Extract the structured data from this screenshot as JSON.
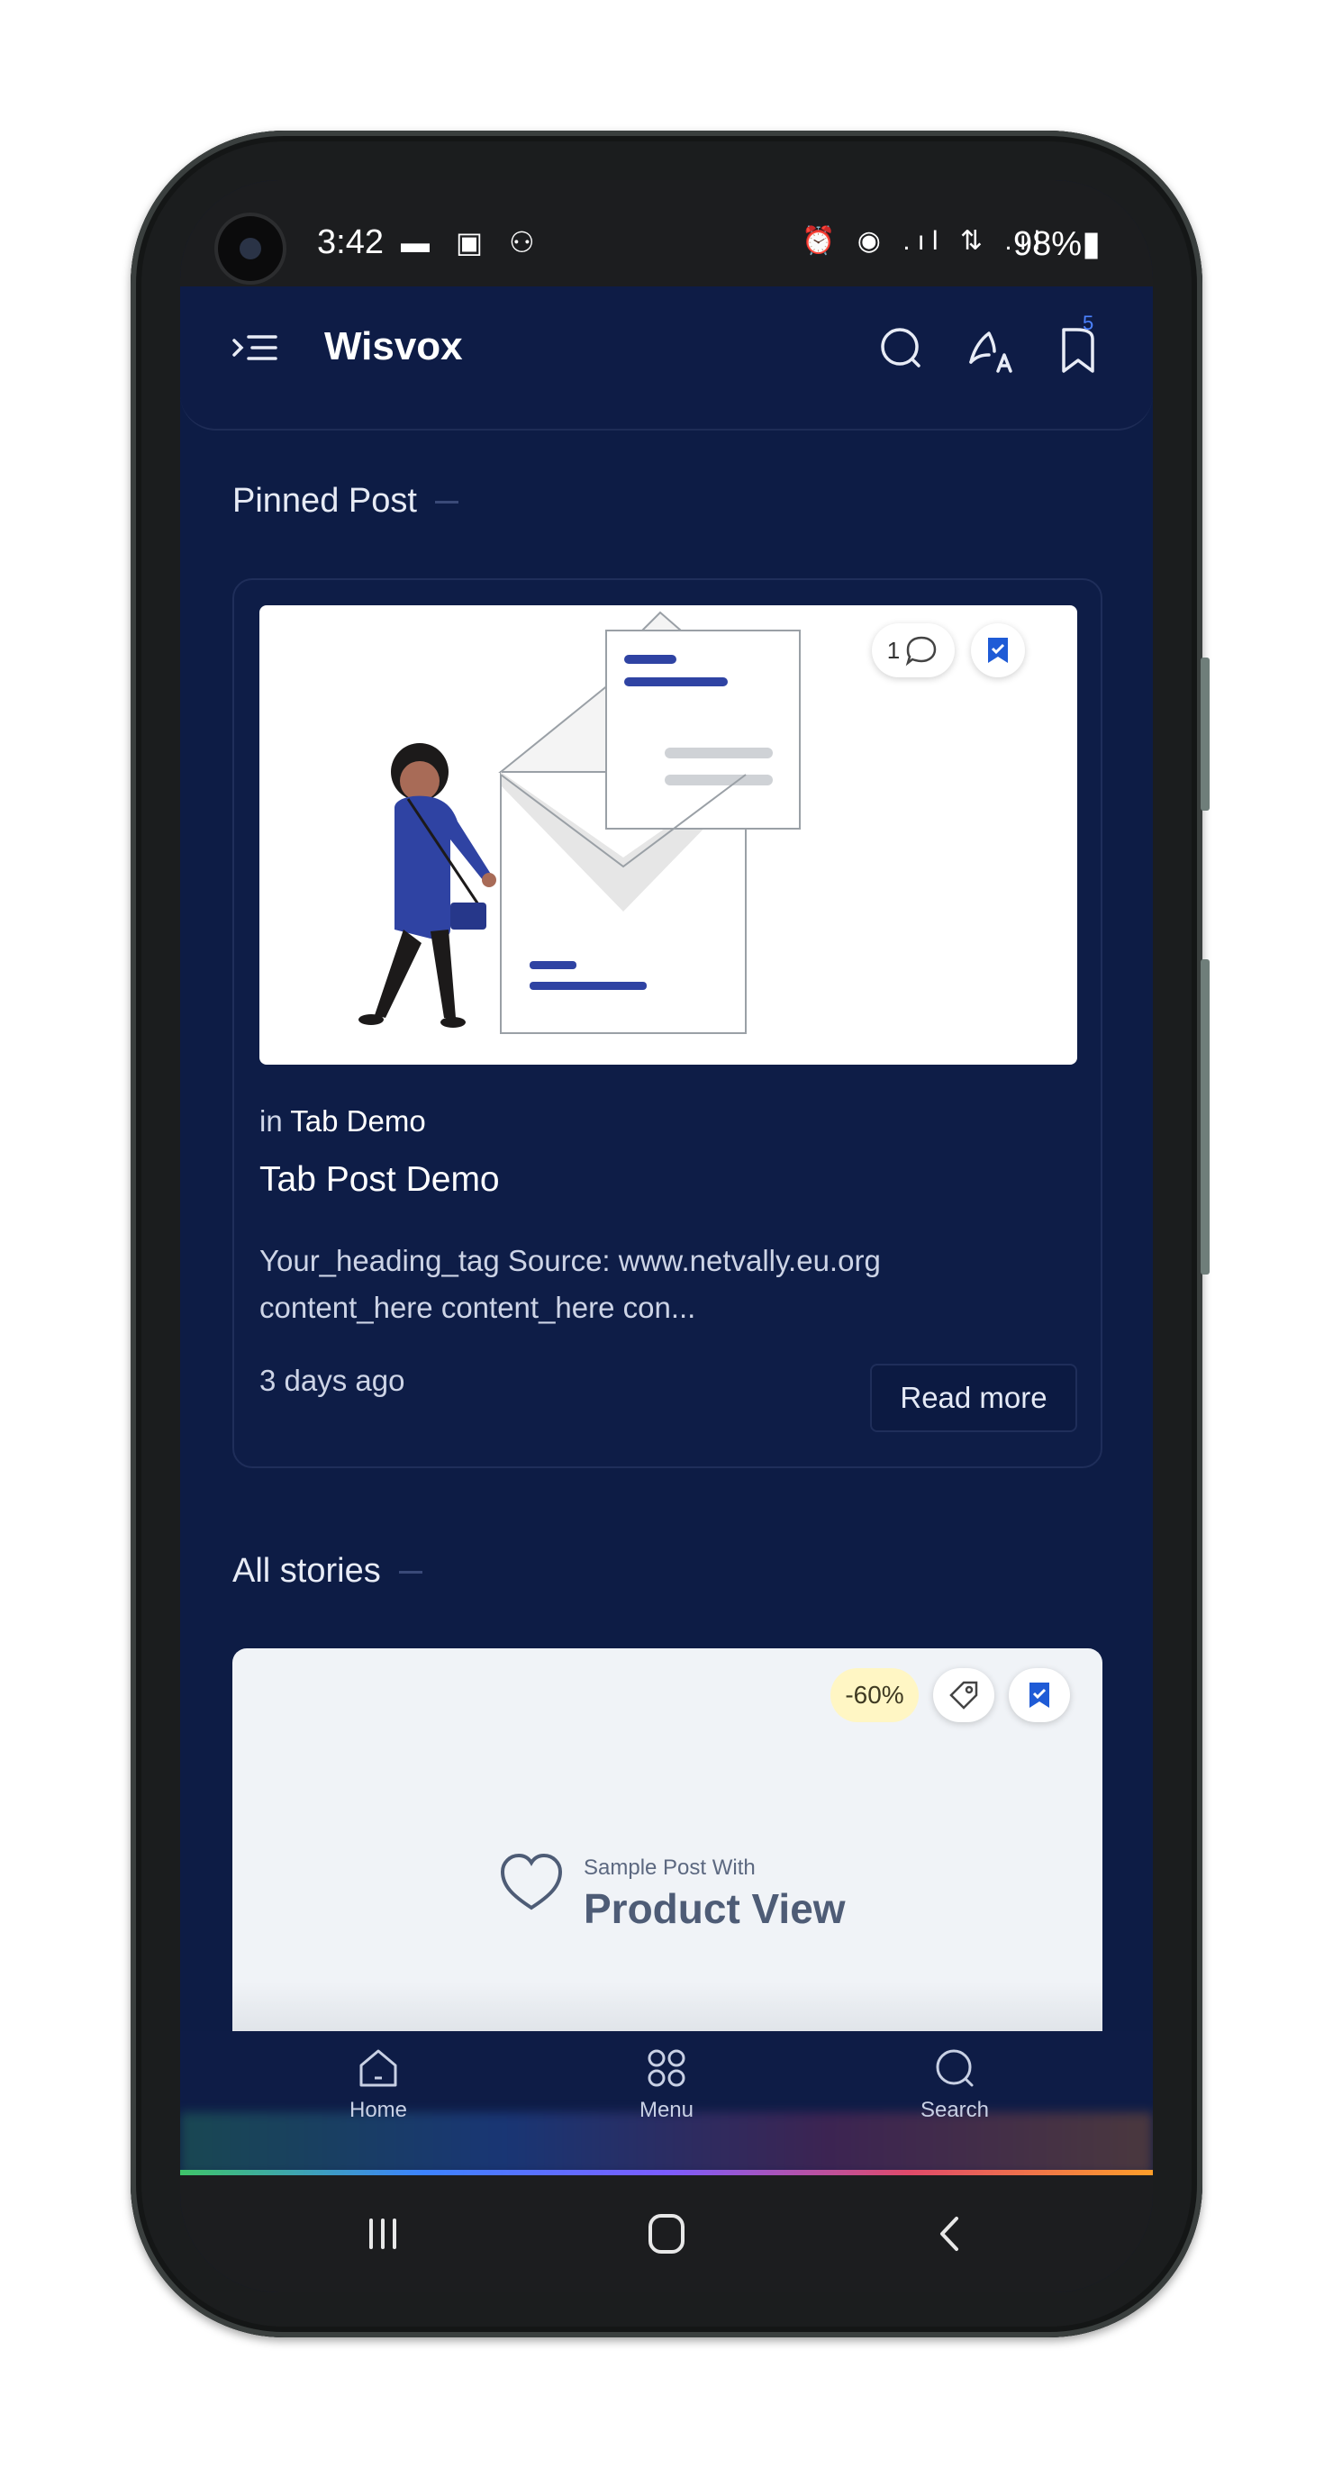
{
  "status_bar": {
    "time": "3:42",
    "left_icons": "▬ ▣ ⚇",
    "right_icons": "⏰ ◉ .ıl ⇅ .ıl",
    "battery": "98%"
  },
  "header": {
    "brand": "Wisvox",
    "bookmark_count": "5",
    "icons": [
      "menu-icon",
      "search-icon",
      "translate-icon",
      "bookmark-icon"
    ]
  },
  "pinned": {
    "section_title": "Pinned Post",
    "comment_count": "1",
    "category_prefix": "in",
    "category": "Tab Demo",
    "title": "Tab Post Demo",
    "excerpt": "Your_heading_tag Source: www.netvally.eu.org content_here content_here con...",
    "time_ago": "3 days ago",
    "read_more": "Read more"
  },
  "stories": {
    "section_title": "All stories",
    "discount": "-60%",
    "image_small_text": "Sample Post With",
    "image_big_text": "Product View"
  },
  "bottom_nav": [
    {
      "label": "Home",
      "icon": "home-icon"
    },
    {
      "label": "Menu",
      "icon": "grid-icon"
    },
    {
      "label": "Search",
      "icon": "search-icon"
    }
  ],
  "colors": {
    "background": "#0d1c45",
    "accent": "#1f5bd6",
    "text": "#ffffff"
  }
}
